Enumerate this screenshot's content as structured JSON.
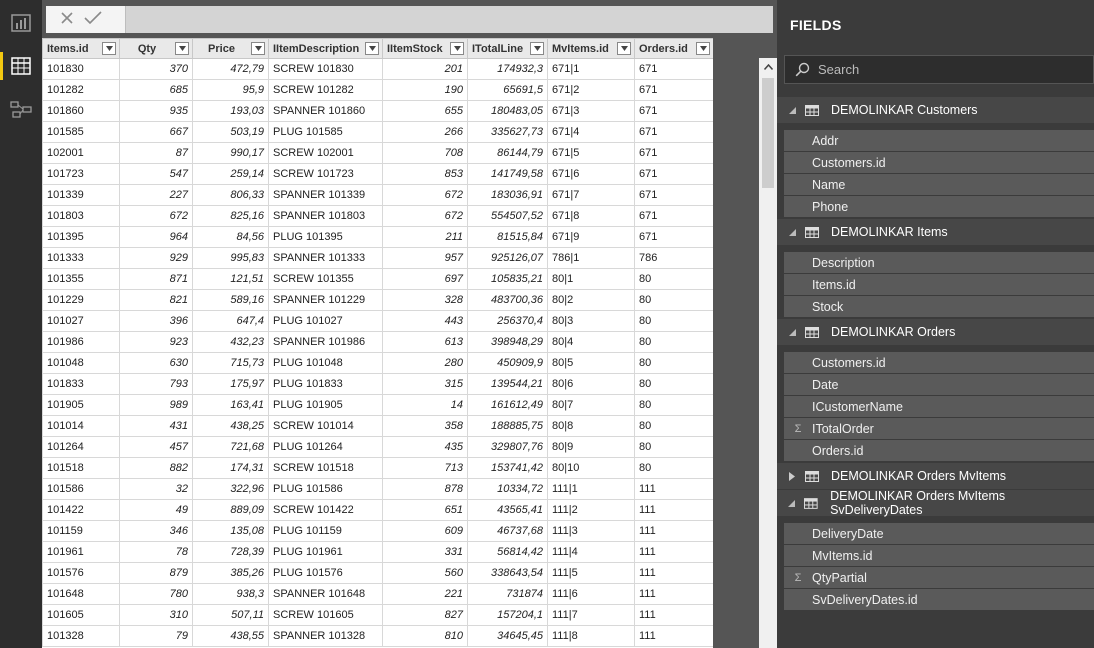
{
  "formula_bar": {
    "value": ""
  },
  "grid": {
    "columns": [
      {
        "label": "Items.id",
        "align": "left"
      },
      {
        "label": "Qty",
        "align": "center"
      },
      {
        "label": "Price",
        "align": "center"
      },
      {
        "label": "IItemDescription",
        "align": "left"
      },
      {
        "label": "IItemStock",
        "align": "left"
      },
      {
        "label": "ITotalLine",
        "align": "left"
      },
      {
        "label": "MvItems.id",
        "align": "left"
      },
      {
        "label": "Orders.id",
        "align": "left"
      }
    ],
    "rows": [
      [
        "101830",
        "370",
        "472,79",
        "SCREW 101830",
        "201",
        "174932,3",
        "671|1",
        "671"
      ],
      [
        "101282",
        "685",
        "95,9",
        "SCREW 101282",
        "190",
        "65691,5",
        "671|2",
        "671"
      ],
      [
        "101860",
        "935",
        "193,03",
        "SPANNER 101860",
        "655",
        "180483,05",
        "671|3",
        "671"
      ],
      [
        "101585",
        "667",
        "503,19",
        "PLUG 101585",
        "266",
        "335627,73",
        "671|4",
        "671"
      ],
      [
        "102001",
        "87",
        "990,17",
        "SCREW 102001",
        "708",
        "86144,79",
        "671|5",
        "671"
      ],
      [
        "101723",
        "547",
        "259,14",
        "SCREW 101723",
        "853",
        "141749,58",
        "671|6",
        "671"
      ],
      [
        "101339",
        "227",
        "806,33",
        "SPANNER 101339",
        "672",
        "183036,91",
        "671|7",
        "671"
      ],
      [
        "101803",
        "672",
        "825,16",
        "SPANNER 101803",
        "672",
        "554507,52",
        "671|8",
        "671"
      ],
      [
        "101395",
        "964",
        "84,56",
        "PLUG 101395",
        "211",
        "81515,84",
        "671|9",
        "671"
      ],
      [
        "101333",
        "929",
        "995,83",
        "SPANNER 101333",
        "957",
        "925126,07",
        "786|1",
        "786"
      ],
      [
        "101355",
        "871",
        "121,51",
        "SCREW 101355",
        "697",
        "105835,21",
        "80|1",
        "80"
      ],
      [
        "101229",
        "821",
        "589,16",
        "SPANNER 101229",
        "328",
        "483700,36",
        "80|2",
        "80"
      ],
      [
        "101027",
        "396",
        "647,4",
        "PLUG 101027",
        "443",
        "256370,4",
        "80|3",
        "80"
      ],
      [
        "101986",
        "923",
        "432,23",
        "SPANNER 101986",
        "613",
        "398948,29",
        "80|4",
        "80"
      ],
      [
        "101048",
        "630",
        "715,73",
        "PLUG 101048",
        "280",
        "450909,9",
        "80|5",
        "80"
      ],
      [
        "101833",
        "793",
        "175,97",
        "PLUG 101833",
        "315",
        "139544,21",
        "80|6",
        "80"
      ],
      [
        "101905",
        "989",
        "163,41",
        "PLUG 101905",
        "14",
        "161612,49",
        "80|7",
        "80"
      ],
      [
        "101014",
        "431",
        "438,25",
        "SCREW 101014",
        "358",
        "188885,75",
        "80|8",
        "80"
      ],
      [
        "101264",
        "457",
        "721,68",
        "PLUG 101264",
        "435",
        "329807,76",
        "80|9",
        "80"
      ],
      [
        "101518",
        "882",
        "174,31",
        "SCREW 101518",
        "713",
        "153741,42",
        "80|10",
        "80"
      ],
      [
        "101586",
        "32",
        "322,96",
        "PLUG 101586",
        "878",
        "10334,72",
        "111|1",
        "111"
      ],
      [
        "101422",
        "49",
        "889,09",
        "SCREW 101422",
        "651",
        "43565,41",
        "111|2",
        "111"
      ],
      [
        "101159",
        "346",
        "135,08",
        "PLUG 101159",
        "609",
        "46737,68",
        "111|3",
        "111"
      ],
      [
        "101961",
        "78",
        "728,39",
        "PLUG 101961",
        "331",
        "56814,42",
        "111|4",
        "111"
      ],
      [
        "101576",
        "879",
        "385,26",
        "PLUG 101576",
        "560",
        "338643,54",
        "111|5",
        "111"
      ],
      [
        "101648",
        "780",
        "938,3",
        "SPANNER 101648",
        "221",
        "731874",
        "111|6",
        "111"
      ],
      [
        "101605",
        "310",
        "507,11",
        "SCREW 101605",
        "827",
        "157204,1",
        "111|7",
        "111"
      ],
      [
        "101328",
        "79",
        "438,55",
        "SPANNER 101328",
        "810",
        "34645,45",
        "111|8",
        "111"
      ]
    ]
  },
  "fields_pane": {
    "title": "FIELDS",
    "search_placeholder": "Search",
    "tables": [
      {
        "name": "DEMOLINKAR Customers",
        "expanded": true,
        "fields": [
          {
            "name": "Addr",
            "sigma": false
          },
          {
            "name": "Customers.id",
            "sigma": false
          },
          {
            "name": "Name",
            "sigma": false
          },
          {
            "name": "Phone",
            "sigma": false
          }
        ]
      },
      {
        "name": "DEMOLINKAR Items",
        "expanded": true,
        "fields": [
          {
            "name": "Description",
            "sigma": false
          },
          {
            "name": "Items.id",
            "sigma": false
          },
          {
            "name": "Stock",
            "sigma": false
          }
        ]
      },
      {
        "name": "DEMOLINKAR Orders",
        "expanded": true,
        "fields": [
          {
            "name": "Customers.id",
            "sigma": false
          },
          {
            "name": "Date",
            "sigma": false
          },
          {
            "name": "ICustomerName",
            "sigma": false
          },
          {
            "name": "ITotalOrder",
            "sigma": true
          },
          {
            "name": "Orders.id",
            "sigma": false
          }
        ]
      },
      {
        "name": "DEMOLINKAR Orders MvItems",
        "expanded": false,
        "fields": []
      },
      {
        "name": "DEMOLINKAR Orders MvItems SvDeliveryDates",
        "expanded": true,
        "fields": [
          {
            "name": "DeliveryDate",
            "sigma": false
          },
          {
            "name": "MvItems.id",
            "sigma": false
          },
          {
            "name": "QtyPartial",
            "sigma": true
          },
          {
            "name": "SvDeliveryDates.id",
            "sigma": false
          }
        ]
      }
    ]
  }
}
